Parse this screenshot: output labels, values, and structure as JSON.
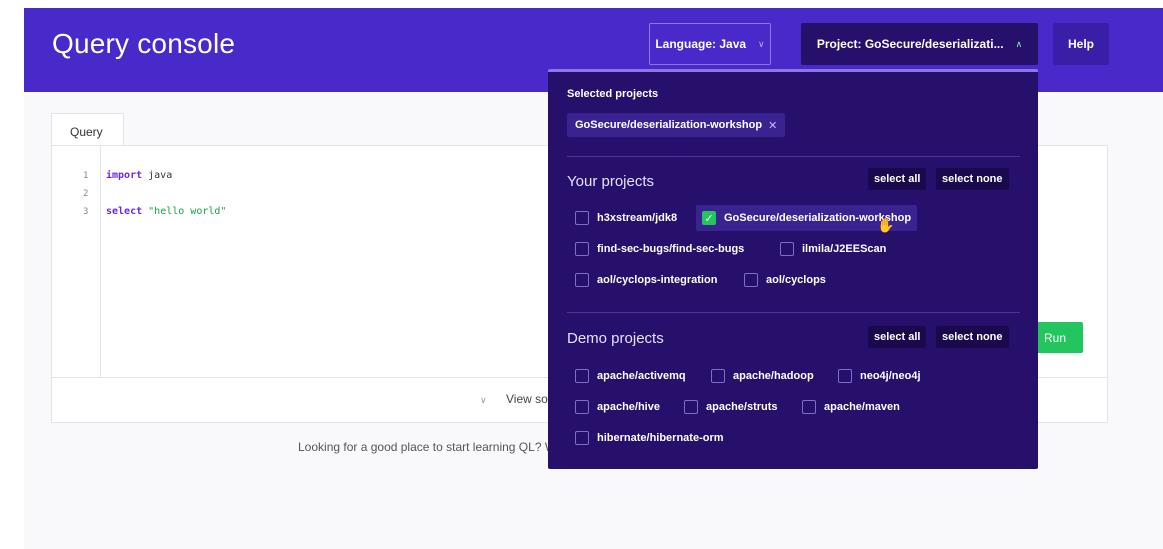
{
  "header": {
    "title": "Query console",
    "language_button": "Language: Java",
    "project_button": "Project: GoSecure/deserializati...",
    "help_button": "Help"
  },
  "editor": {
    "tab_label": "Query",
    "lines": [
      {
        "num": "1",
        "keyword": "import",
        "rest": " java"
      },
      {
        "num": "2",
        "keyword": "",
        "rest": ""
      },
      {
        "num": "3",
        "keyword": "select",
        "string": "\"hello world\""
      }
    ],
    "run_button": "Run",
    "view_results": "View so",
    "learning_text": "Looking for a good place to start learning QL? W"
  },
  "dropdown": {
    "selected_heading": "Selected projects",
    "selected_chip": "GoSecure/deserialization-workshop",
    "your_projects": {
      "heading": "Your projects",
      "select_all": "select all",
      "select_none": "select none",
      "items": [
        {
          "label": "h3xstream/jdk8",
          "checked": false
        },
        {
          "label": "GoSecure/deserialization-workshop",
          "checked": true
        },
        {
          "label": "find-sec-bugs/find-sec-bugs",
          "checked": false
        },
        {
          "label": "ilmila/J2EEScan",
          "checked": false
        },
        {
          "label": "aol/cyclops-integration",
          "checked": false
        },
        {
          "label": "aol/cyclops",
          "checked": false
        }
      ]
    },
    "demo_projects": {
      "heading": "Demo projects",
      "select_all": "select all",
      "select_none": "select none",
      "items": [
        {
          "label": "apache/activemq",
          "checked": false
        },
        {
          "label": "apache/hadoop",
          "checked": false
        },
        {
          "label": "neo4j/neo4j",
          "checked": false
        },
        {
          "label": "apache/hive",
          "checked": false
        },
        {
          "label": "apache/struts",
          "checked": false
        },
        {
          "label": "apache/maven",
          "checked": false
        },
        {
          "label": "hibernate/hibernate-orm",
          "checked": false
        }
      ]
    }
  },
  "colors": {
    "header_bg": "#4929c9",
    "dropdown_bg": "#26106b",
    "accent_green": "#22c55e"
  }
}
